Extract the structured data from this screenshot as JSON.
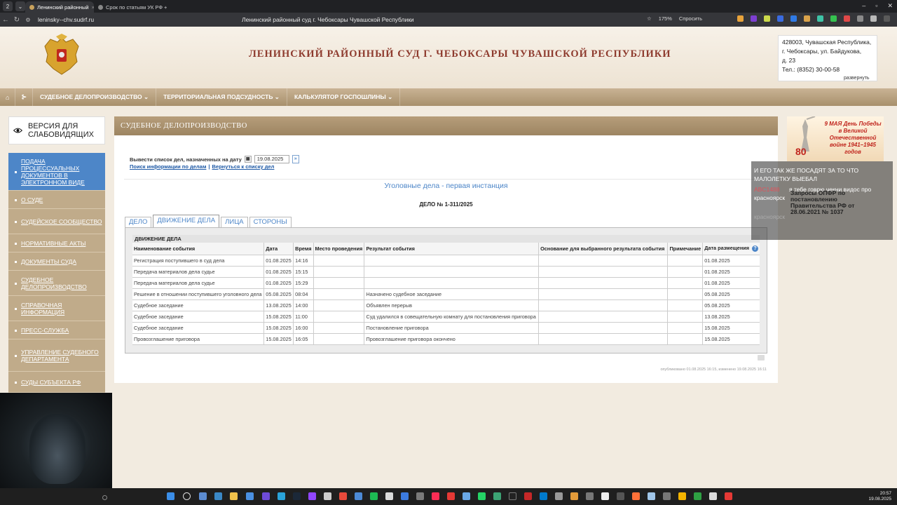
{
  "browser": {
    "tabs": [
      {
        "label": "Ленинский районный",
        "active": true
      },
      {
        "label": "Срок по статьям УК РФ",
        "active": false
      }
    ],
    "url": "leninsky--chv.sudrf.ru",
    "page_title": "Ленинский районный суд г. Чебоксары Чувашской Республики",
    "zoom": "175%",
    "ask_label": "Спросить"
  },
  "header": {
    "site_title": "ЛЕНИНСКИЙ РАЙОННЫЙ СУД Г. ЧЕБОКСАРЫ ЧУВАШСКОЙ РЕСПУБЛИКИ",
    "address_lines": [
      "428003, Чувашская Республика,",
      "г. Чебоксары, ул. Байдукова,",
      "д. 23",
      "Тел.: (8352) 30-00-58"
    ],
    "expand_label": "развернуть"
  },
  "menu": {
    "items": [
      "СУДЕБНОЕ ДЕЛОПРОИЗВОДСТВО ⌄",
      "ТЕРРИТОРИАЛЬНАЯ ПОДСУДНОСТЬ ⌄",
      "КАЛЬКУЛЯТОР ГОСПОШЛИНЫ ⌄"
    ]
  },
  "vision": {
    "label": "ВЕРСИЯ ДЛЯ СЛАБОВИДЯЩИХ"
  },
  "sidebar": {
    "items": [
      "ПОДАЧА ПРОЦЕССУАЛЬНЫХ ДОКУМЕНТОВ В ЭЛЕКТРОННОМ ВИДЕ",
      "О СУДЕ",
      "СУДЕЙСКОЕ СООБЩЕСТВО",
      "НОРМАТИВНЫЕ АКТЫ",
      "ДОКУМЕНТЫ СУДА",
      "СУДЕБНОЕ ДЕЛОПРОИЗВОДСТВО",
      "СПРАВОЧНАЯ ИНФОРМАЦИЯ",
      "ПРЕСС-СЛУЖБА",
      "УПРАВЛЕНИЕ СУДЕБНОГО ДЕПАРТАМЕНТА",
      "СУДЫ СУБЪЕКТА РФ"
    ]
  },
  "banner": {
    "text": "9 МАЯ День Победы в Великой Отечественной войне 1941–1945 годов",
    "number": "80"
  },
  "chat": {
    "lines": [
      {
        "user": "",
        "text": "И ЕГО ТАК ЖЕ ПОСАДЯТ ЗА ТО ЧТО"
      },
      {
        "user": "",
        "text": "МАЛОЛЕТКУ ВЫЕБАЛ"
      },
      {
        "user": "ABC1488",
        "text": "я тебе говрю чекни видос про"
      },
      {
        "user": "",
        "text": "красноярск"
      },
      {
        "user": "",
        "text": "Запросы ОПФР по"
      },
      {
        "user": "",
        "text": "постановлению"
      },
      {
        "user": "",
        "text": "Правительства РФ от"
      },
      {
        "user": "",
        "text": "28.06.2021 № 1037"
      },
      {
        "user": "",
        "text": "красноярск"
      }
    ]
  },
  "content": {
    "section_header": "СУДЕБНОЕ ДЕЛОПРОИЗВОДСТВО",
    "date_label": "Вывести список дел, назначенных на дату",
    "date_value": "19.08.2025",
    "link_search": "Поиск информации по делам",
    "link_back": "Вернуться к списку дел",
    "section_title": "Уголовные дела - первая инстанция",
    "case_number": "ДЕЛО № 1-311/2025",
    "tabs": [
      "ДЕЛО",
      "ДВИЖЕНИЕ ДЕЛА",
      "ЛИЦА",
      "СТОРОНЫ"
    ],
    "panel_title": "ДВИЖЕНИЕ ДЕЛА",
    "columns": [
      "Наименование события",
      "Дата",
      "Время",
      "Место проведения",
      "Результат события",
      "Основание для выбранного результата события",
      "Примечание",
      "Дата размещения"
    ],
    "rows": [
      [
        "Регистрация поступившего в суд дела",
        "01.08.2025",
        "14:16",
        "",
        "",
        "",
        "",
        "01.08.2025"
      ],
      [
        "Передача материалов дела судье",
        "01.08.2025",
        "15:15",
        "",
        "",
        "",
        "",
        "01.08.2025"
      ],
      [
        "Передача материалов дела судье",
        "01.08.2025",
        "15:29",
        "",
        "",
        "",
        "",
        "01.08.2025"
      ],
      [
        "Решение в отношении поступившего уголовного дела",
        "05.08.2025",
        "08:04",
        "",
        "Назначено судебное заседание",
        "",
        "",
        "05.08.2025"
      ],
      [
        "Судебное заседание",
        "13.08.2025",
        "14:00",
        "",
        "Объявлен перерыв",
        "",
        "",
        "05.08.2025"
      ],
      [
        "Судебное заседание",
        "15.08.2025",
        "11:00",
        "",
        "Суд удалился в совещательную комнату для постановления приговора",
        "",
        "",
        "13.08.2025"
      ],
      [
        "Судебное заседание",
        "15.08.2025",
        "16:00",
        "",
        "Постановление приговора",
        "",
        "",
        "15.08.2025"
      ],
      [
        "Провозглашение приговора",
        "15.08.2025",
        "16:05",
        "",
        "Провозглашение приговора окончено",
        "",
        "",
        "15.08.2025"
      ]
    ],
    "footer_note": "опубликовано 01.08.2025 16:15, изменено 19.08.2025 16:11"
  },
  "taskbar": {
    "time": "20:57",
    "date": "19.08.2025"
  }
}
